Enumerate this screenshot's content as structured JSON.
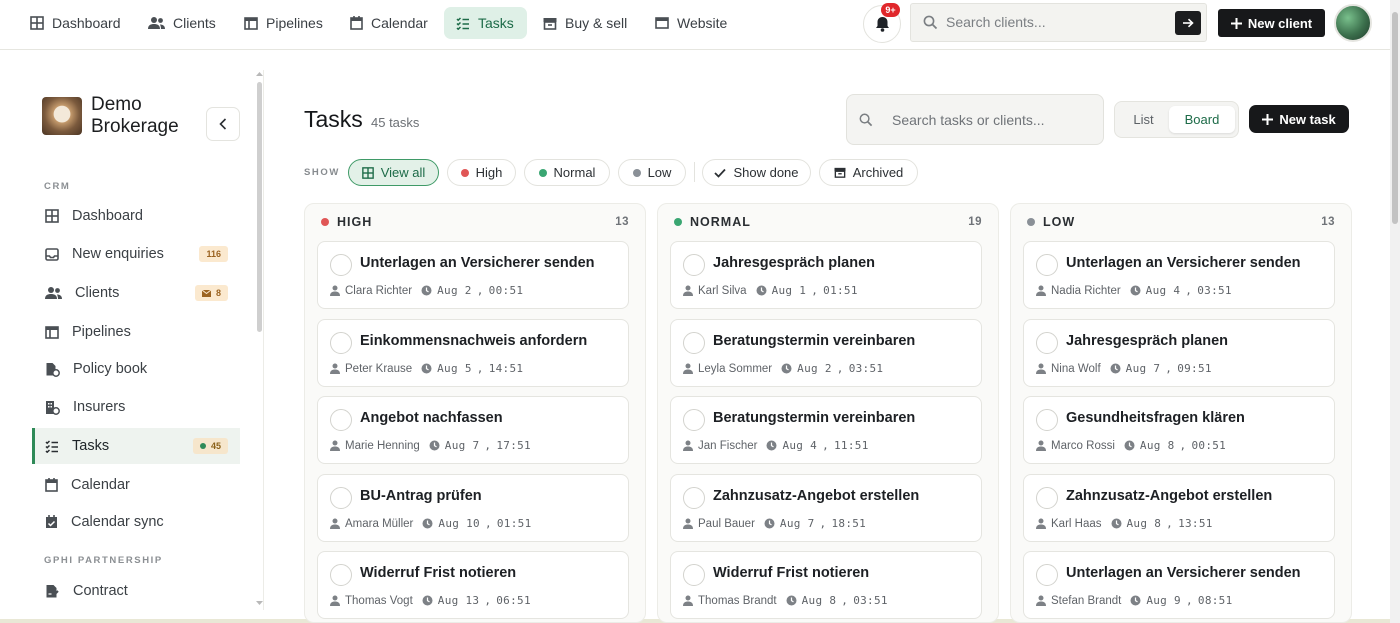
{
  "nav": {
    "items": [
      {
        "label": "Dashboard",
        "icon": "grid-icon"
      },
      {
        "label": "Clients",
        "icon": "users-icon"
      },
      {
        "label": "Pipelines",
        "icon": "columns-icon"
      },
      {
        "label": "Calendar",
        "icon": "calendar-icon"
      },
      {
        "label": "Tasks",
        "icon": "checklist-icon",
        "active": true
      },
      {
        "label": "Buy & sell",
        "icon": "archive-icon"
      },
      {
        "label": "Website",
        "icon": "browser-icon"
      }
    ],
    "notifications_badge": "9+",
    "search_placeholder": "Search clients...",
    "new_client_label": "New client"
  },
  "sidebar": {
    "brand": "Demo Brokerage",
    "sections": [
      {
        "title": "CRM",
        "items": [
          {
            "label": "Dashboard",
            "icon": "grid-icon"
          },
          {
            "label": "New enquiries",
            "icon": "inbox-icon",
            "badge": "116"
          },
          {
            "label": "Clients",
            "icon": "users-icon",
            "badge": "8",
            "badge_icon": "mail-icon"
          },
          {
            "label": "Pipelines",
            "icon": "columns-icon"
          },
          {
            "label": "Policy book",
            "icon": "document-icon"
          },
          {
            "label": "Insurers",
            "icon": "building-icon"
          },
          {
            "label": "Tasks",
            "icon": "checklist-icon",
            "badge": "45",
            "badge_icon": "green-dot",
            "active": true
          },
          {
            "label": "Calendar",
            "icon": "calendar-icon"
          },
          {
            "label": "Calendar sync",
            "icon": "calendar-check-icon"
          }
        ]
      },
      {
        "title": "GPHI PARTNERSHIP",
        "items": [
          {
            "label": "Contract",
            "icon": "contract-icon"
          }
        ]
      }
    ]
  },
  "main": {
    "title": "Tasks",
    "count_label": "45 tasks",
    "search_placeholder": "Search tasks or clients...",
    "view_options": [
      "List",
      "Board"
    ],
    "active_view": "Board",
    "new_task_label": "New task",
    "show_label": "SHOW",
    "filters": [
      {
        "label": "View all",
        "icon": "grid-icon",
        "active": true
      },
      {
        "label": "High",
        "color": "#e05656"
      },
      {
        "label": "Normal",
        "color": "#3aa672"
      },
      {
        "label": "Low",
        "color": "#8a9097"
      },
      {
        "label": "Show done",
        "icon": "check-icon"
      },
      {
        "label": "Archived",
        "icon": "archive-icon"
      }
    ]
  },
  "colors": {
    "accent": "#1d6b48",
    "high": "#e05656",
    "normal": "#3aa672",
    "low": "#8a9097"
  },
  "columns": [
    {
      "label": "HIGH",
      "count": "13",
      "color": "#e05656",
      "cards": [
        {
          "title": "Unterlagen an Versicherer senden",
          "client": "Clara Richter",
          "date": "Aug 2",
          "time": "00:51"
        },
        {
          "title": "Einkommensnachweis anfordern",
          "client": "Peter Krause",
          "date": "Aug 5",
          "time": "14:51"
        },
        {
          "title": "Angebot nachfassen",
          "client": "Marie Henning",
          "date": "Aug 7",
          "time": "17:51"
        },
        {
          "title": "BU-Antrag prüfen",
          "client": "Amara Müller",
          "date": "Aug 10",
          "time": "01:51"
        },
        {
          "title": "Widerruf Frist notieren",
          "client": "Thomas Vogt",
          "date": "Aug 13",
          "time": "06:51"
        }
      ]
    },
    {
      "label": "NORMAL",
      "count": "19",
      "color": "#3aa672",
      "cards": [
        {
          "title": "Jahresgespräch planen",
          "client": "Karl Silva",
          "date": "Aug 1",
          "time": "01:51"
        },
        {
          "title": "Beratungstermin vereinbaren",
          "client": "Leyla Sommer",
          "date": "Aug 2",
          "time": "03:51"
        },
        {
          "title": "Beratungstermin vereinbaren",
          "client": "Jan Fischer",
          "date": "Aug 4",
          "time": "11:51"
        },
        {
          "title": "Zahnzusatz-Angebot erstellen",
          "client": "Paul Bauer",
          "date": "Aug 7",
          "time": "18:51"
        },
        {
          "title": "Widerruf Frist notieren",
          "client": "Thomas Brandt",
          "date": "Aug 8",
          "time": "03:51"
        }
      ]
    },
    {
      "label": "LOW",
      "count": "13",
      "color": "#8a9097",
      "cards": [
        {
          "title": "Unterlagen an Versicherer senden",
          "client": "Nadia Richter",
          "date": "Aug 4",
          "time": "03:51"
        },
        {
          "title": "Jahresgespräch planen",
          "client": "Nina Wolf",
          "date": "Aug 7",
          "time": "09:51"
        },
        {
          "title": "Gesundheitsfragen klären",
          "client": "Marco Rossi",
          "date": "Aug 8",
          "time": "00:51"
        },
        {
          "title": "Zahnzusatz-Angebot erstellen",
          "client": "Karl Haas",
          "date": "Aug 8",
          "time": "13:51"
        },
        {
          "title": "Unterlagen an Versicherer senden",
          "client": "Stefan Brandt",
          "date": "Aug 9",
          "time": "08:51"
        }
      ]
    }
  ]
}
